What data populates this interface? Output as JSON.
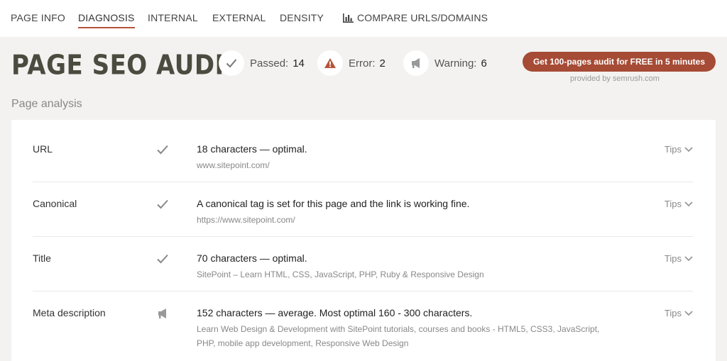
{
  "nav": {
    "items": [
      {
        "label": "PAGE INFO"
      },
      {
        "label": "DIAGNOSIS"
      },
      {
        "label": "INTERNAL"
      },
      {
        "label": "EXTERNAL"
      },
      {
        "label": "DENSITY"
      },
      {
        "label": "COMPARE URLS/DOMAINS",
        "icon": "bar-chart-icon"
      }
    ],
    "active": "DIAGNOSIS"
  },
  "header": {
    "title": "PAGE SEO AUDIT",
    "stats": {
      "passed": {
        "label": "Passed:",
        "value": "14",
        "icon": "check-icon"
      },
      "error": {
        "label": "Error:",
        "value": "2",
        "icon": "warning-triangle-icon"
      },
      "warning": {
        "label": "Warning:",
        "value": "6",
        "icon": "megaphone-icon"
      }
    },
    "cta_label": "Get 100-pages audit for FREE in 5 minutes",
    "provided_by": "provided by  semrush.com"
  },
  "analysis": {
    "heading": "Page analysis",
    "tips_label": "Tips",
    "rows": [
      {
        "label": "URL",
        "status": "passed",
        "status_icon": "check-icon",
        "message": "18 characters — optimal.",
        "detail": "www.sitepoint.com/"
      },
      {
        "label": "Canonical",
        "status": "passed",
        "status_icon": "check-icon",
        "message": "A canonical tag is set for this page and the link is working fine.",
        "detail": "https://www.sitepoint.com/"
      },
      {
        "label": "Title",
        "status": "passed",
        "status_icon": "check-icon",
        "message": "70 characters — optimal.",
        "detail": "SitePoint – Learn HTML, CSS, JavaScript, PHP, Ruby & Responsive Design"
      },
      {
        "label": "Meta description",
        "status": "warning",
        "status_icon": "megaphone-icon",
        "message": "152 characters — average. Most optimal 160 - 300 characters.",
        "detail": "Learn Web Design & Development with SitePoint tutorials, courses and books - HTML5, CSS3, JavaScript, PHP, mobile app development, Responsive Web Design"
      }
    ]
  },
  "colors": {
    "accent": "#a64b35",
    "error": "#b5543a",
    "title": "#4b4b40",
    "background": "#f3f2f0"
  }
}
